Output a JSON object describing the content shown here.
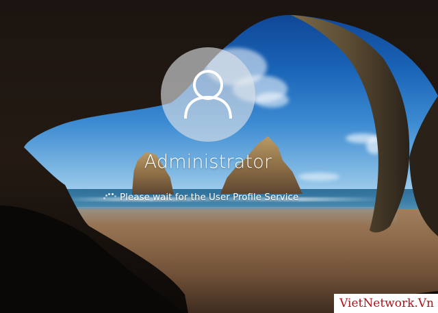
{
  "login_screen": {
    "avatar_icon": "user-silhouette-icon",
    "username": "Administrator",
    "status": {
      "spinner_icon": "loading-dots-icon",
      "message": "Please wait for the User Profile Service"
    }
  },
  "watermark": {
    "text": "VietNetwork.Vn",
    "color": "#b0121b"
  },
  "colors": {
    "text": "#ffffff",
    "avatar_fill": "#e1e4e8"
  }
}
